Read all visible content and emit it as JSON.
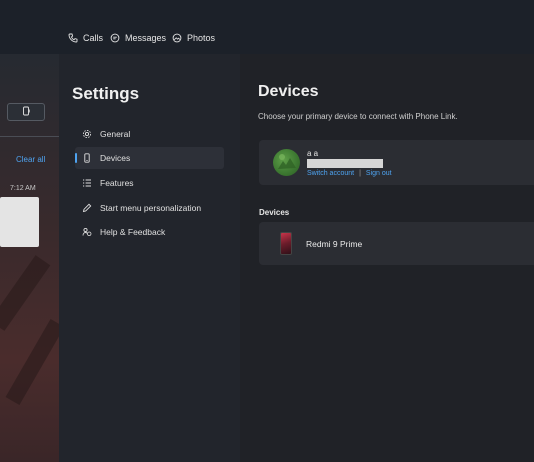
{
  "nav": {
    "tabs": [
      {
        "label": "Calls",
        "icon": "phone-icon"
      },
      {
        "label": "Messages",
        "icon": "chat-bubble-icon"
      },
      {
        "label": "Photos",
        "icon": "photos-icon"
      }
    ]
  },
  "left_panel": {
    "clear_all": "Clear all",
    "notification_time": "7:12 AM"
  },
  "settings": {
    "title": "Settings",
    "menu": [
      {
        "label": "General",
        "icon": "gear-icon",
        "active": false
      },
      {
        "label": "Devices",
        "icon": "phone-device-icon",
        "active": true
      },
      {
        "label": "Features",
        "icon": "list-icon",
        "active": false
      },
      {
        "label": "Start menu personalization",
        "icon": "pen-icon",
        "active": false
      },
      {
        "label": "Help & Feedback",
        "icon": "help-people-icon",
        "active": false
      }
    ]
  },
  "main": {
    "title": "Devices",
    "subtitle": "Choose your primary device to connect with Phone Link.",
    "account": {
      "name": "a a",
      "switch_account": "Switch account",
      "separator": "|",
      "sign_out": "Sign out"
    },
    "devices_label": "Devices",
    "device": {
      "name": "Redmi 9 Prime"
    }
  },
  "colors": {
    "accent": "#4ea3f0",
    "background": "#202227",
    "card": "#2b2d33"
  }
}
